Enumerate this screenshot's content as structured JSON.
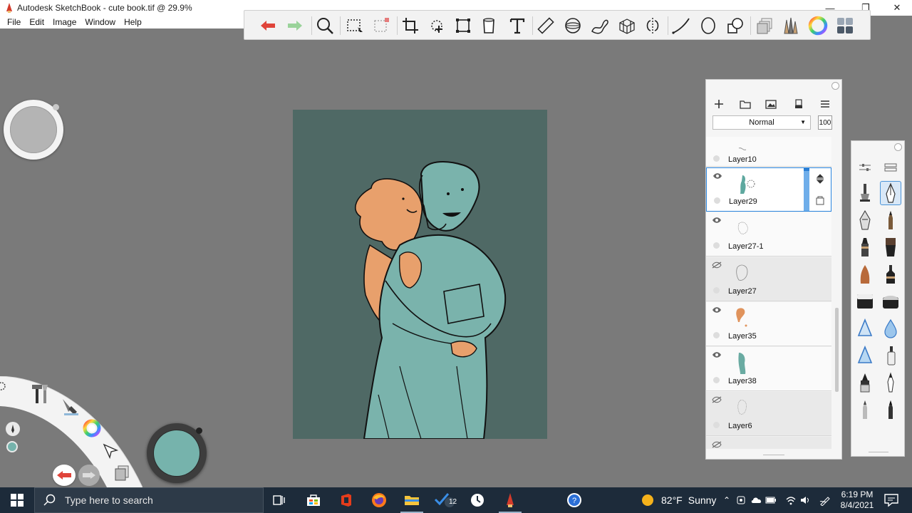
{
  "window": {
    "title": "Autodesk SketchBook - cute book.tif @ 29.9%",
    "controls": {
      "minimize": "—",
      "restore": "❐",
      "close": "✕"
    }
  },
  "menu": [
    "File",
    "Edit",
    "Image",
    "Window",
    "Help"
  ],
  "toolbar": {
    "tools": [
      "undo-icon",
      "redo-icon",
      "zoom-icon",
      "rect-select-icon",
      "lasso-select-icon",
      "crop-icon",
      "transform-icon",
      "distort-icon",
      "fill-icon",
      "text-icon",
      "ruler-icon",
      "ellipse-guide-icon",
      "french-curve-icon",
      "perspective-icon",
      "symmetry-icon",
      "stroke-icon",
      "shape-icon",
      "copic-icon",
      "layer-editor-icon",
      "brush-library-icon",
      "color-wheel-icon",
      "brush-panel-icon"
    ]
  },
  "layers": {
    "blend_mode": "Normal",
    "opacity": "100",
    "items": [
      {
        "name": "Layer10",
        "visible": true,
        "selected": false
      },
      {
        "name": "Layer29",
        "visible": true,
        "selected": true
      },
      {
        "name": "Layer27-1",
        "visible": true,
        "selected": false
      },
      {
        "name": "Layer27",
        "visible": false,
        "selected": false
      },
      {
        "name": "Layer35",
        "visible": true,
        "selected": false
      },
      {
        "name": "Layer38",
        "visible": true,
        "selected": false
      },
      {
        "name": "Layer6",
        "visible": false,
        "selected": false
      }
    ]
  },
  "colors": {
    "canvas_bg": "#4f6965",
    "figure_teal": "#7ab3ac",
    "figure_skin": "#e8a06c",
    "active_color": "#76b3ac",
    "selection_blue": "#2a86e0"
  },
  "taskbar": {
    "search_placeholder": "Type here to search",
    "weather_temp": "82°F",
    "weather_text": "Sunny",
    "time": "6:19 PM",
    "date": "8/4/2021",
    "mail_badge": "12"
  }
}
